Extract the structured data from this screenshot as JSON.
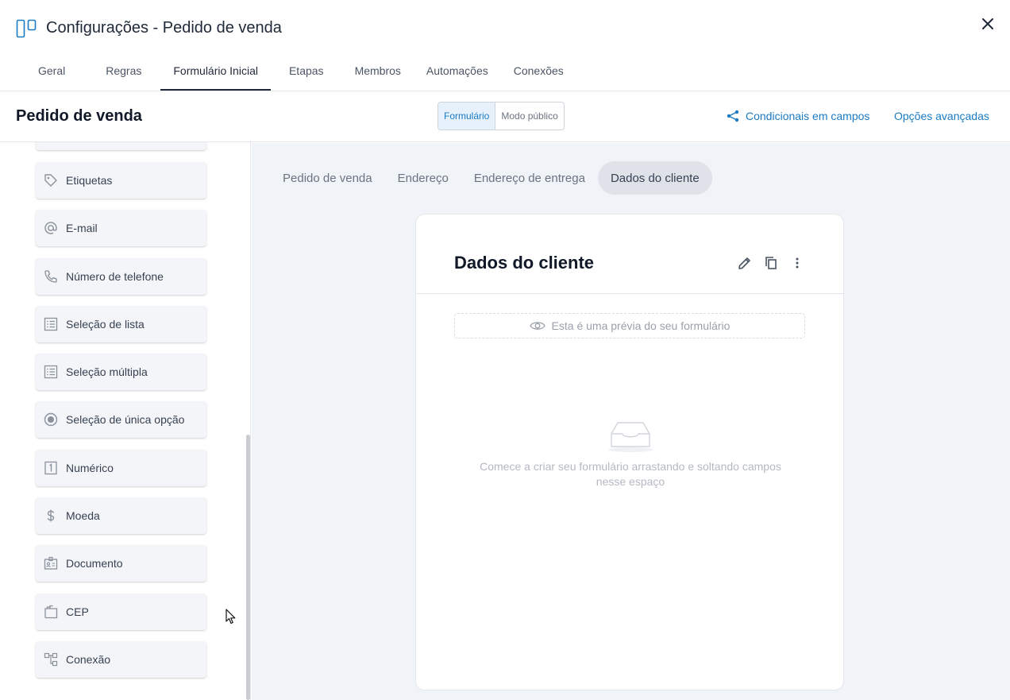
{
  "header": {
    "title": "Configurações - Pedido de venda",
    "tabs": [
      {
        "label": "Geral"
      },
      {
        "label": "Regras"
      },
      {
        "label": "Formulário Inicial",
        "active": true
      },
      {
        "label": "Etapas"
      },
      {
        "label": "Membros"
      },
      {
        "label": "Automações"
      },
      {
        "label": "Conexões"
      }
    ]
  },
  "subheader": {
    "title": "Pedido de venda",
    "modes": [
      {
        "label": "Formulário",
        "active": true
      },
      {
        "label": "Modo público"
      }
    ],
    "conditionals_label": "Condicionais em campos",
    "advanced_label": "Opções avançadas"
  },
  "fields": [
    {
      "label": "Etiquetas",
      "icon": "tag-icon"
    },
    {
      "label": "E-mail",
      "icon": "at-sign-icon"
    },
    {
      "label": "Número de telefone",
      "icon": "phone-icon"
    },
    {
      "label": "Seleção de lista",
      "icon": "list-icon"
    },
    {
      "label": "Seleção múltipla",
      "icon": "checklist-icon"
    },
    {
      "label": "Seleção de única opção",
      "icon": "radio-icon"
    },
    {
      "label": "Numérico",
      "icon": "number-one-icon"
    },
    {
      "label": "Moeda",
      "icon": "dollar-icon"
    },
    {
      "label": "Documento",
      "icon": "id-card-icon"
    },
    {
      "label": "CEP",
      "icon": "mailbox-icon"
    },
    {
      "label": "Conexão",
      "icon": "connection-icon"
    }
  ],
  "sections": [
    {
      "label": "Pedido de venda"
    },
    {
      "label": "Endereço"
    },
    {
      "label": "Endereço de entrega"
    },
    {
      "label": "Dados do cliente",
      "active": true
    }
  ],
  "card": {
    "title": "Dados do cliente",
    "preview_note": "Esta é uma prévia do seu formulário",
    "empty_message": "Comece a criar seu formulário arrastando e soltando campos nesse espaço"
  },
  "colors": {
    "accent": "#1b7bc3",
    "canvas_bg": "#f0f3f7"
  }
}
